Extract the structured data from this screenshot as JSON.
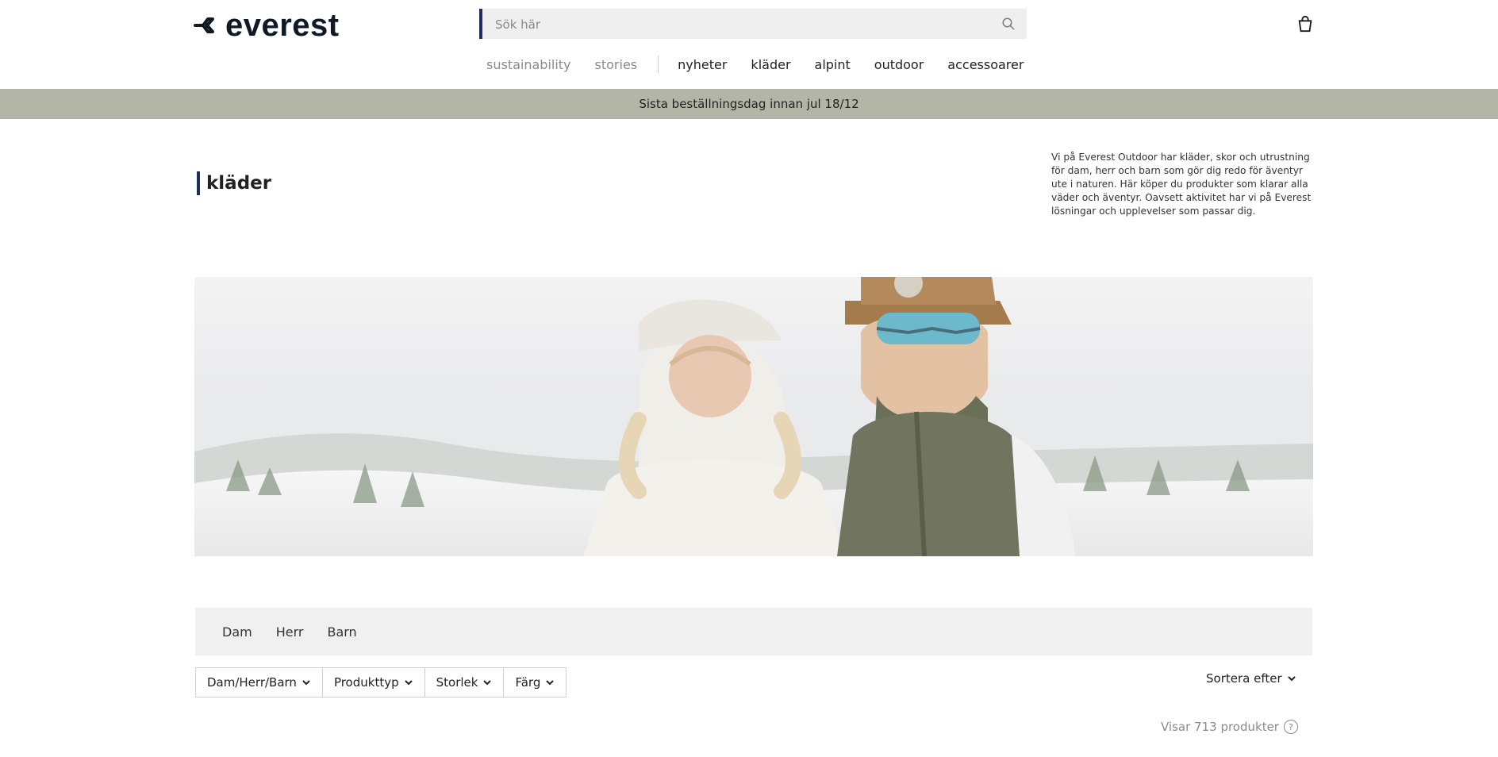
{
  "header": {
    "logo_text": "everest",
    "search": {
      "placeholder": "Sök här"
    },
    "nav": {
      "items": [
        {
          "label": "sustainability",
          "muted": true
        },
        {
          "label": "stories",
          "muted": true
        },
        {
          "label": "nyheter",
          "muted": false
        },
        {
          "label": "kläder",
          "muted": false
        },
        {
          "label": "alpint",
          "muted": false
        },
        {
          "label": "outdoor",
          "muted": false
        },
        {
          "label": "accessoarer",
          "muted": false
        }
      ]
    },
    "cart_icon": "shopping-bag-icon"
  },
  "banner": {
    "text": "Sista beställningsdag innan jul 18/12",
    "bg": "#b3b5a6"
  },
  "page": {
    "title": "kläder",
    "intro": "Vi på Everest Outdoor har kläder, skor och utrustning för dam, herr och barn som gör dig redo för äventyr ute i naturen. Här köper du produkter som klarar alla väder och äventyr. Oavsett aktivitet har vi på Everest lösningar och upplevelser som passar dig."
  },
  "hero": {
    "alt": ""
  },
  "category_tabs": [
    {
      "label": "Dam"
    },
    {
      "label": "Herr"
    },
    {
      "label": "Barn"
    }
  ],
  "filters": [
    {
      "label": "Dam/Herr/Barn"
    },
    {
      "label": "Produkttyp"
    },
    {
      "label": "Storlek"
    },
    {
      "label": "Färg"
    }
  ],
  "sort": {
    "label": "Sortera efter"
  },
  "result": {
    "count_text": "Visar 713 produkter"
  },
  "colors": {
    "accent": "#1c2f5a",
    "banner": "#b3b5a6",
    "tabs_bg": "#f0f0f0"
  }
}
